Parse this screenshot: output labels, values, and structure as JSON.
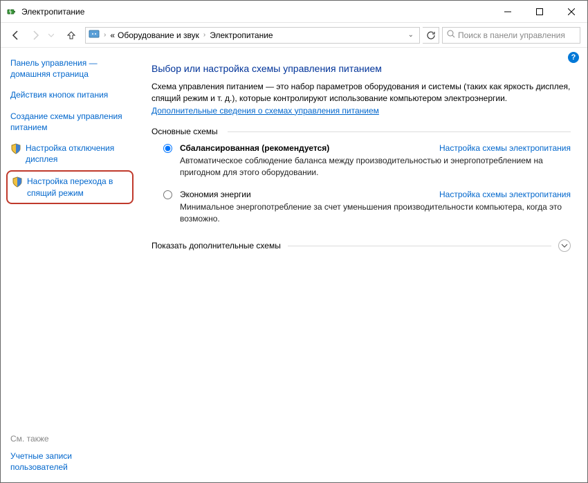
{
  "titlebar": {
    "title": "Электропитание"
  },
  "nav": {
    "crumb1": "Оборудование и звук",
    "crumb2": "Электропитание",
    "crumb_sep": "«",
    "search_placeholder": "Поиск в панели управления"
  },
  "sidebar": {
    "home": "Панель управления — домашняя страница",
    "link1": "Действия кнопок питания",
    "link2": "Создание схемы управления питанием",
    "link3": "Настройка отключения дисплея",
    "link4": "Настройка перехода в спящий режим",
    "seealso_label": "См. также",
    "seealso_link": "Учетные записи пользователей"
  },
  "main": {
    "title": "Выбор или настройка схемы управления питанием",
    "description": "Схема управления питанием — это набор параметров оборудования и системы (таких как яркость дисплея, спящий режим и т. д.), которые контролируют использование компьютером электроэнергии. ",
    "more_link": "Дополнительные сведения о схемах управления питанием",
    "group_main": "Основные схемы",
    "plan1": {
      "name": "Сбалансированная (рекомендуется)",
      "desc": "Автоматическое соблюдение баланса между производительностью и энергопотреблением на пригодном для этого оборудовании."
    },
    "plan2": {
      "name": "Экономия энергии",
      "desc": "Минимальное энергопотребление за счет уменьшения производительности компьютера, когда это возможно."
    },
    "change_link": "Настройка схемы электропитания",
    "expand_label": "Показать дополнительные схемы"
  }
}
